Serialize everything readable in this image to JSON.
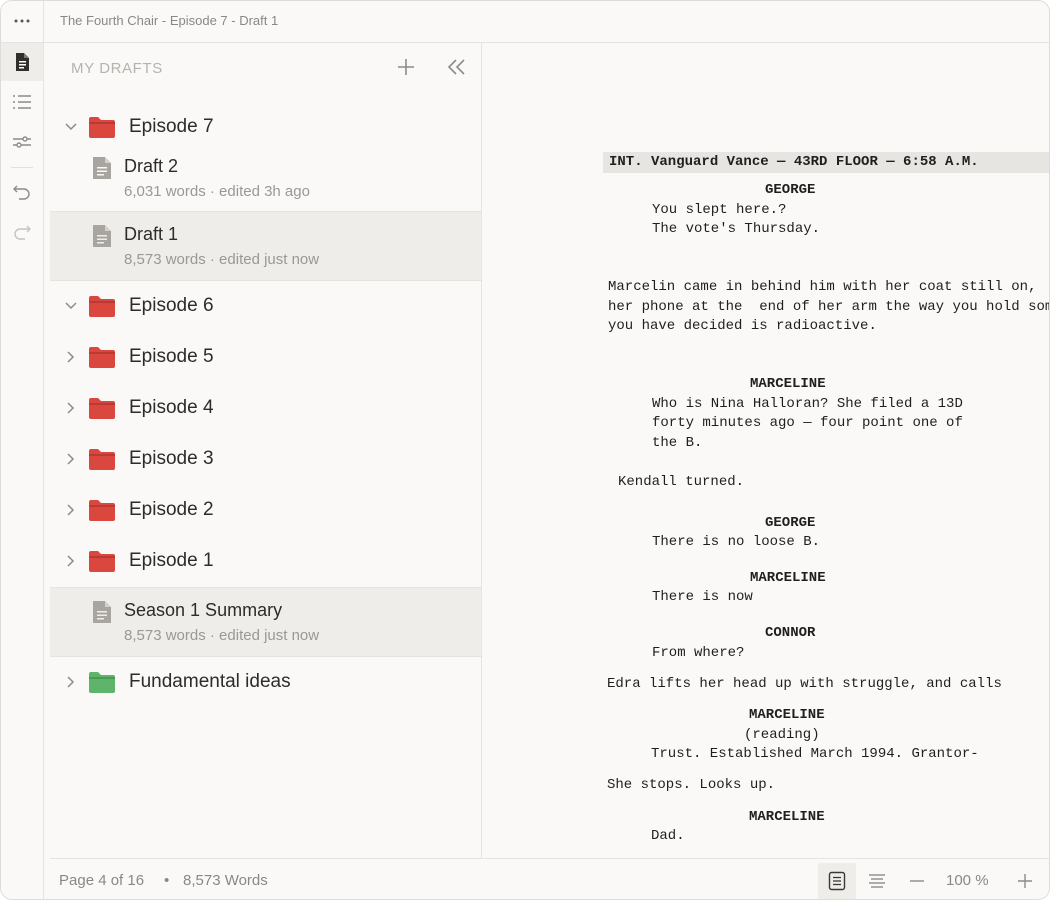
{
  "window": {
    "title": "The Fourth Chair - Episode 7 - Draft 1",
    "menu_glyph": "···"
  },
  "rail": {
    "items": [
      {
        "icon": "document-icon",
        "active": true
      },
      {
        "icon": "outline-list-icon",
        "active": false
      },
      {
        "icon": "sliders-icon",
        "active": false
      },
      {
        "icon": "undo-icon",
        "active": false
      },
      {
        "icon": "redo-icon",
        "active": false
      }
    ]
  },
  "sidebar": {
    "header": "MY DRAFTS",
    "folders": [
      {
        "label": "Episode 7",
        "color": "#d9473f",
        "expanded": true
      },
      {
        "label": "Episode 6",
        "color": "#d9473f",
        "expanded": true
      },
      {
        "label": "Episode 5",
        "color": "#d9473f",
        "expanded": false
      },
      {
        "label": "Episode 4",
        "color": "#d9473f",
        "expanded": false
      },
      {
        "label": "Episode 3",
        "color": "#d9473f",
        "expanded": false
      },
      {
        "label": "Episode 2",
        "color": "#d9473f",
        "expanded": false
      },
      {
        "label": "Episode 1",
        "color": "#d9473f",
        "expanded": false
      },
      {
        "label": "Fundamental ideas",
        "color": "#5fb46b",
        "expanded": false
      }
    ],
    "docs": [
      {
        "title": "Draft 2",
        "meta": "6,031 words · edited 3h ago",
        "selected": false
      },
      {
        "title": "Draft 1",
        "meta": "8,573  words · edited just now",
        "selected": true
      },
      {
        "title": "Season 1 Summary",
        "meta": "8,573  words · edited just now",
        "selected": true
      }
    ]
  },
  "script": {
    "slugline": "INT. Vanguard Vance — 43RD FLOOR — 6:58 A.M.",
    "lines": [
      "GEORGE",
      "You slept here.?",
      "The vote's Thursday.",
      "Marcelin came in behind him with her coat still on,",
      "her phone at the  end of her arm the way you hold something",
      "you have decided is radioactive.",
      "MARCELINE",
      "Who is Nina Halloran? She filed a 13D",
      "forty minutes ago — four point one of",
      "the B.",
      "Kendall turned.",
      "GEORGE",
      "There is no loose B.",
      "MARCELINE",
      "There is now",
      "CONNOR",
      "From where?",
      "Edra lifts her head up with struggle, and calls",
      "MARCELINE",
      "(reading)",
      "Trust. Established March 1994. Grantor-",
      "She stops. Looks up.",
      "MARCELINE",
      "Dad."
    ]
  },
  "status": {
    "page": "Page 4 of 16",
    "separator": "•",
    "words": "8,573 Words",
    "zoom": "100 %"
  },
  "colors": {
    "accent_red_folder": "#d9473f",
    "accent_green_folder": "#5fb46b",
    "background": "#faf9f7",
    "selected_row": "#efedea"
  }
}
